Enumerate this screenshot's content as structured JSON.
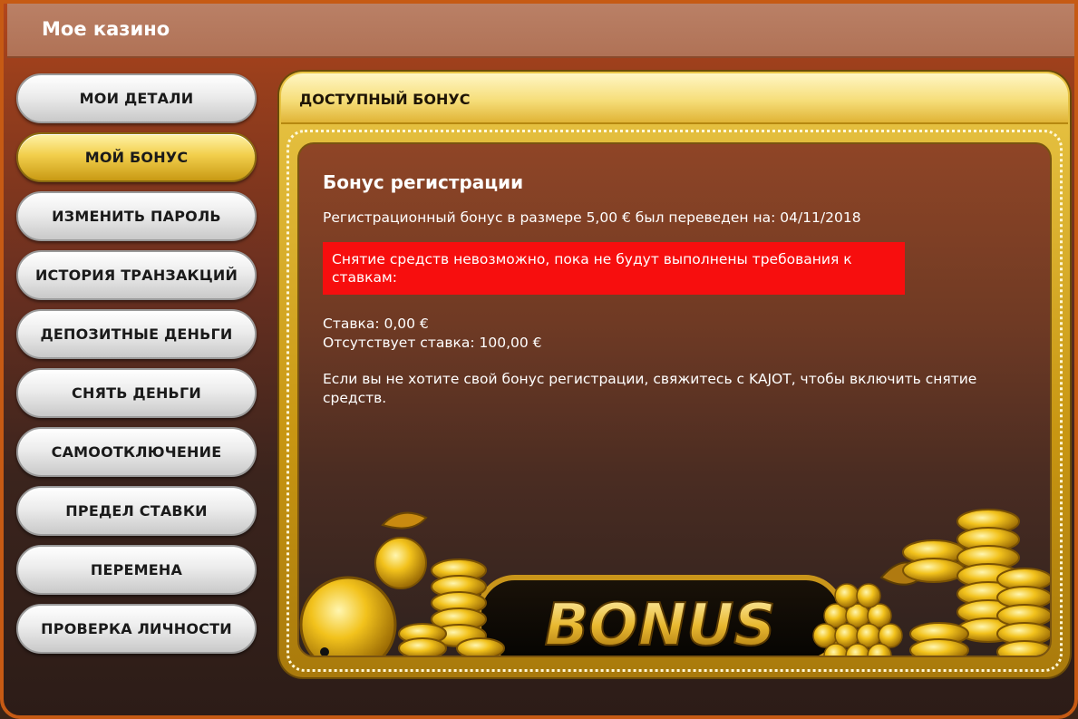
{
  "app": {
    "title": "Мое казино"
  },
  "nav": {
    "items": [
      {
        "label": "МОИ ДЕТАЛИ",
        "active": false
      },
      {
        "label": "МОЙ БОНУС",
        "active": true
      },
      {
        "label": "ИЗМЕНИТЬ ПАРОЛЬ",
        "active": false
      },
      {
        "label": "ИСТОРИЯ ТРАНЗАКЦИЙ",
        "active": false
      },
      {
        "label": "ДЕПОЗИТНЫЕ ДЕНЬГИ",
        "active": false
      },
      {
        "label": "СНЯТЬ ДЕНЬГИ",
        "active": false
      },
      {
        "label": "САМООТКЛЮЧЕНИЕ",
        "active": false
      },
      {
        "label": "ПРЕДЕЛ СТАВКИ",
        "active": false
      },
      {
        "label": "ПЕРЕМЕНА",
        "active": false
      },
      {
        "label": "ПРОВЕРКА ЛИЧНОСТИ",
        "active": false
      }
    ]
  },
  "panel": {
    "title": "ДОСТУПНЫЙ БОНУС",
    "bonus_heading": "Бонус регистрации",
    "bonus_transfer": "Регистрационный бонус в размере 5,00 € был переведен на: 04/11/2018",
    "alert": "Снятие средств невозможно, пока не будут выполнены требования к ставкам:",
    "stake": "Ставка: 0,00 €",
    "missing_stake": "Отсутствует ставка: 100,00 €",
    "note": "Если вы не хотите свой бонус регистрации, свяжитесь с KAJOT, чтобы включить снятие средств.",
    "banner_text": "BONUS"
  },
  "colors": {
    "accent_gold": "#f2cf4c",
    "alert_red": "#f70e0e",
    "titlebar": "#b07256"
  }
}
